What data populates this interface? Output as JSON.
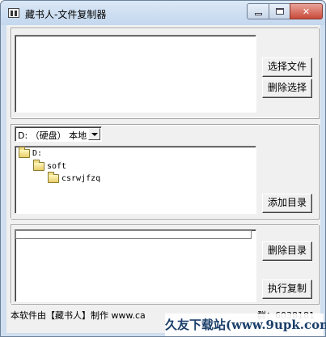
{
  "window": {
    "title": "藏书人-文件复制器",
    "close_glyph": "✕"
  },
  "files": {
    "select_button": "选择文件",
    "delete_button": "删除选择"
  },
  "drive": {
    "selected": "D: （硬盘） 本地"
  },
  "tree": {
    "items": [
      "D:",
      "soft",
      "csrwjfzq"
    ],
    "add_button": "添加目录"
  },
  "targets": {
    "delete_dir_button": "删除目录",
    "execute_button": "执行复制"
  },
  "status": {
    "text": "本软件由【藏书人】制作 www.ca",
    "partial": "群：6038181"
  },
  "watermark": {
    "text": "久友下载站(www.9upk.com)"
  }
}
